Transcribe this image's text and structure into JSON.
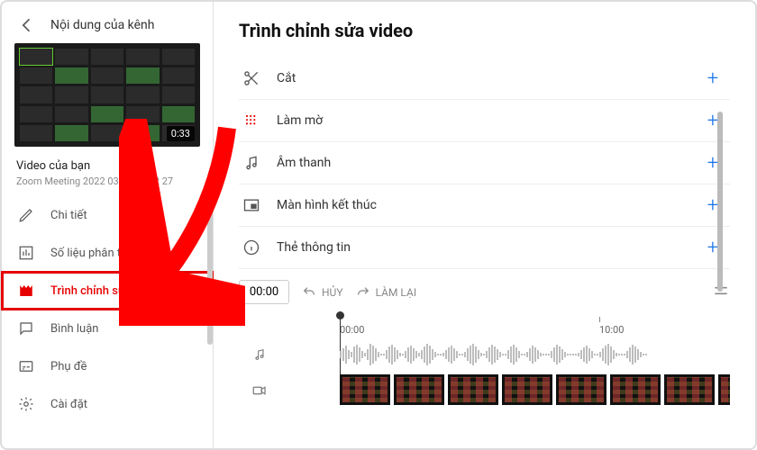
{
  "sidebar": {
    "header": "Nội dung của kênh",
    "thumb_duration": "0:33",
    "video_title": "Video của bạn",
    "video_subtitle": "Zoom Meeting 2022 03 30 08 02 27",
    "items": [
      {
        "icon": "pencil",
        "label": "Chi tiết"
      },
      {
        "icon": "analytics",
        "label": "Số liệu phân tích"
      },
      {
        "icon": "editor",
        "label": "Trình chỉnh sửa"
      },
      {
        "icon": "comments",
        "label": "Bình luận"
      },
      {
        "icon": "subtitles",
        "label": "Phụ đề"
      },
      {
        "icon": "settings",
        "label": "Cài đặt"
      }
    ]
  },
  "main": {
    "title": "Trình chỉnh sửa video",
    "tools": [
      {
        "icon": "cut",
        "label": "Cắt"
      },
      {
        "icon": "blur",
        "label": "Làm mờ"
      },
      {
        "icon": "audio",
        "label": "Âm thanh"
      },
      {
        "icon": "endscreen",
        "label": "Màn hình kết thúc"
      },
      {
        "icon": "info",
        "label": "Thẻ thông tin"
      }
    ],
    "timeline": {
      "current": "00:00",
      "undo": "HỦY",
      "redo": "LÀM LẠI",
      "marks": [
        "00:00",
        "10:00"
      ]
    }
  }
}
